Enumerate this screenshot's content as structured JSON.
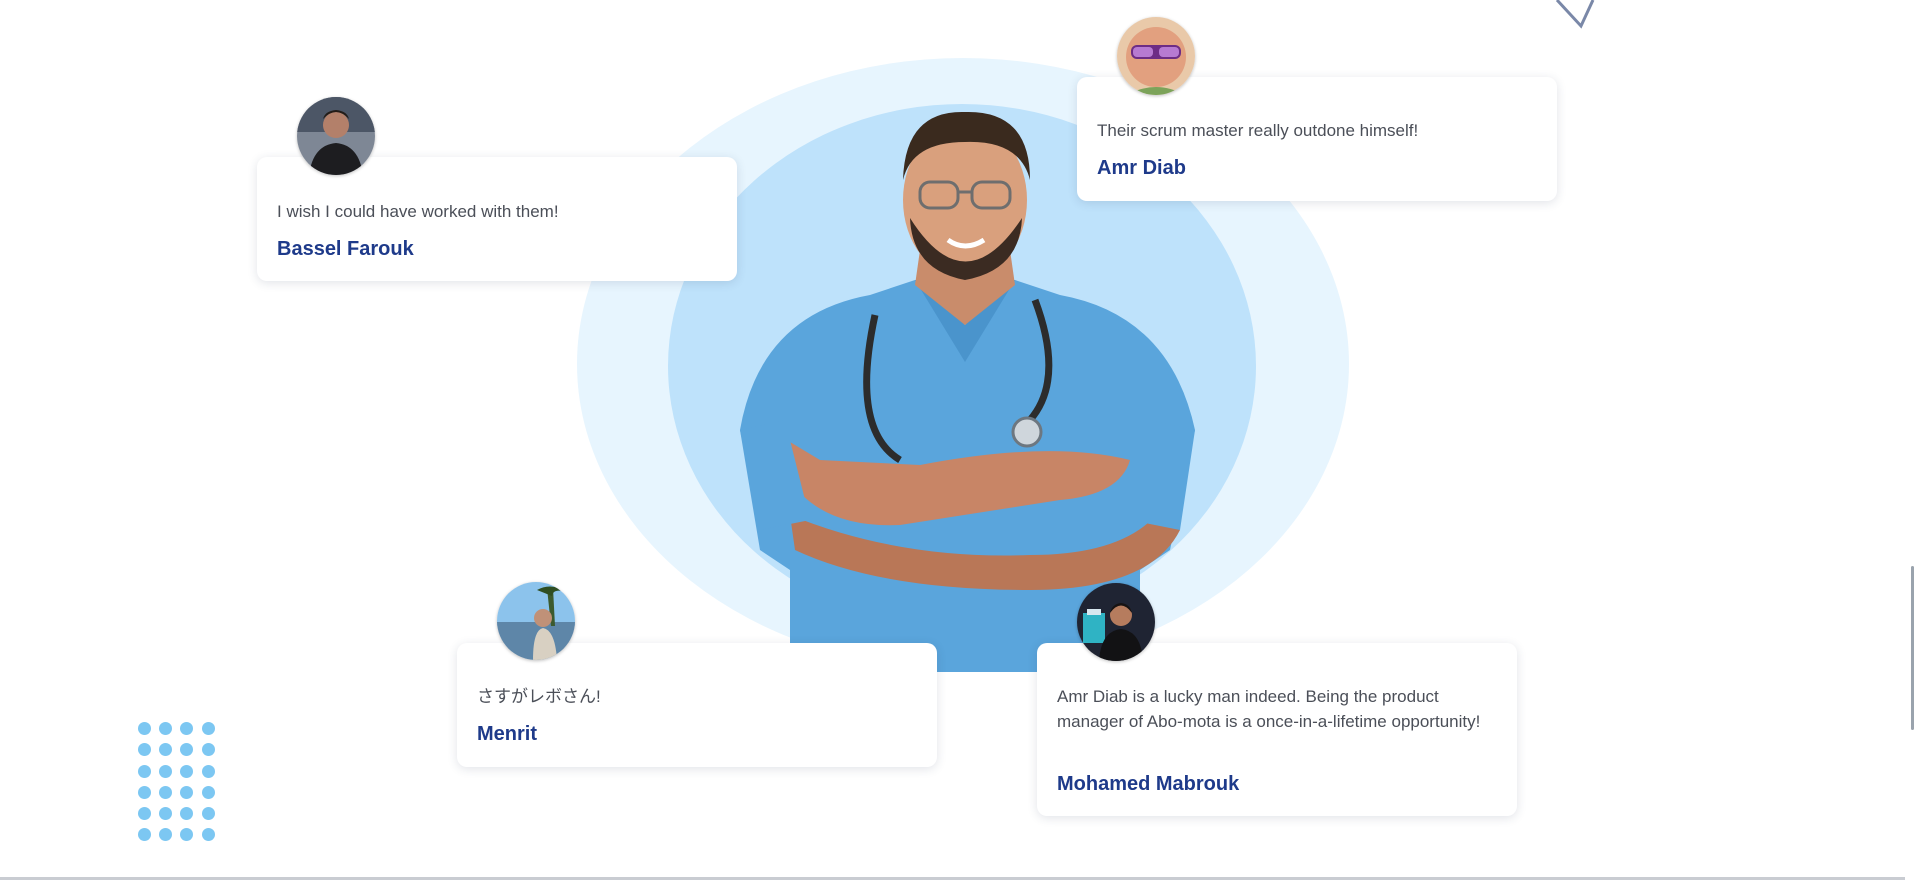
{
  "colors": {
    "accent_name": "#1e3a8a",
    "quote_text": "#4b4f58",
    "ring_outer": "#e7f5fe",
    "ring_inner": "#bee2fb",
    "dots": "#7cc7f2",
    "scrubs": "#5aa5dc"
  },
  "hero": {
    "image": "doctor-in-blue-scrubs-with-stethoscope"
  },
  "testimonials": [
    {
      "quote": "I wish I could have worked with them!",
      "name": "Bassel Farouk",
      "avatar": "avatar-photo"
    },
    {
      "quote": "Their scrum master really outdone himself!",
      "name": "Amr Diab",
      "avatar": "avatar-photo"
    },
    {
      "quote": "さすがレボさん!",
      "name": "Menrit",
      "avatar": "avatar-photo"
    },
    {
      "quote": "Amr Diab is a lucky man indeed. Being the product manager of Abo-mota is a once-in-a-lifetime opportunity!",
      "name": "Mohamed Mabrouk",
      "avatar": "avatar-photo"
    }
  ],
  "decorations": {
    "dot_grid": "dot-grid-decoration",
    "corner_icon": "check-icon"
  }
}
